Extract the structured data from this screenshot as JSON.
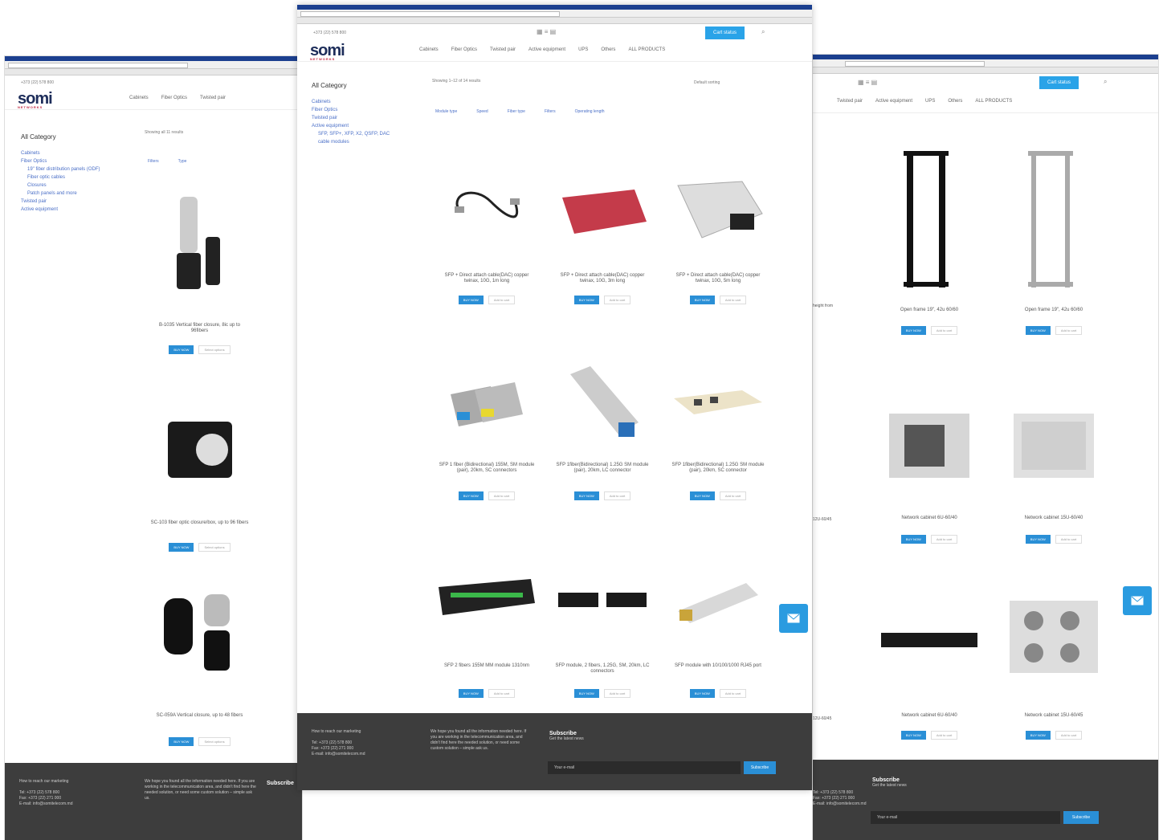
{
  "brand": {
    "name": "somi",
    "tagline": "NETWORKS"
  },
  "topbar": {
    "phone": "+373 (22) 578 800",
    "phone_short": "+373 (22) 578 800",
    "cart_label": "Cart status"
  },
  "menu": {
    "items": [
      "Cabinets",
      "Fiber Optics",
      "Twisted pair",
      "Active equipment",
      "UPS",
      "Others",
      "ALL PRODUCTS"
    ]
  },
  "sidebar": {
    "caption": "All Category",
    "left_items": [
      "Cabinets",
      "Fiber Optics",
      "19\" fiber distribution panels (ODF)",
      "Fiber optic cables",
      "Closures",
      "Patch panels and more",
      "Twisted pair",
      "Active equipment"
    ],
    "center_items": [
      "Cabinets",
      "Fiber Optics",
      "Twisted pair",
      "Active equipment",
      "SFP, SFP+, XFP, X2, QSFP, DAC",
      "cable modules"
    ]
  },
  "left_window": {
    "showing": "Showing all 11 results",
    "filters": [
      "Filters",
      "Type"
    ],
    "products": [
      {
        "name": "B-1035 Vertical fiber closure, 8ic up to 96fibers",
        "buy": "BUY NOW",
        "more": "Select options"
      },
      {
        "name": "SC-103 fiber optic closure/box, up to 96 fibers",
        "buy": "BUY NOW",
        "more": "Select options"
      },
      {
        "name": "SC-059A Vertical closure, up to 48 fibers",
        "buy": "BUY NOW",
        "more": "Select options"
      }
    ]
  },
  "center_window": {
    "showing": "Showing 1–12 of 14 results",
    "sort": "Default sorting",
    "filters": [
      "Module type",
      "Speed",
      "Fiber type",
      "Filters",
      "Operating length"
    ],
    "products": [
      {
        "name": "SFP + Direct attach cable(DAC) copper twinax, 10G, 1m long",
        "buy": "BUY NOW",
        "more": "Add to cart"
      },
      {
        "name": "SFP + Direct attach cable(DAC) copper twinax, 10G, 3m long",
        "buy": "BUY NOW",
        "more": "Add to cart"
      },
      {
        "name": "SFP + Direct attach cable(DAC) copper twinax, 10G, 5m long",
        "buy": "BUY NOW",
        "more": "Add to cart"
      },
      {
        "name": "SFP 1 fiber (Bidirectional) 155M, SM module (pair), 20km, SC connectors",
        "buy": "BUY NOW",
        "more": "Add to cart"
      },
      {
        "name": "SFP 1fiber(Bidirectional) 1.25G SM module (pair), 20km, LC connector",
        "buy": "BUY NOW",
        "more": "Add to cart"
      },
      {
        "name": "SFP 1fiber(Bidirectional) 1.25G SM module (pair), 20km, SC connector",
        "buy": "BUY NOW",
        "more": "Add to cart"
      },
      {
        "name": "SFP 2 fibers 155M MM module 1310nm",
        "buy": "BUY NOW",
        "more": "Add to cart"
      },
      {
        "name": "SFP module, 2 fibers, 1.25G, SM, 20km, LC connectors",
        "buy": "BUY NOW",
        "more": "Add to cart"
      },
      {
        "name": "SFP module with 10/100/1000 RJ45 port",
        "buy": "BUY NOW",
        "more": "Add to cart"
      }
    ]
  },
  "right_window": {
    "products": [
      {
        "name": "Open frame 19\", 42u 60/60",
        "buy": "BUY NOW",
        "more": "Add to cart"
      },
      {
        "name": "Open frame 19\", 42u 60/60",
        "buy": "BUY NOW",
        "more": "Add to cart"
      },
      {
        "name": "Network cabinet 6U-60/40",
        "buy": "BUY NOW",
        "more": "Add to cart"
      },
      {
        "name": "Network cabinet 15U-60/40",
        "buy": "BUY NOW",
        "more": "Add to cart"
      },
      {
        "name": "Network cabinet 6U-60/40",
        "buy": "BUY NOW",
        "more": "Add to cart"
      },
      {
        "name": "Network cabinet 15U-60/45",
        "buy": "BUY NOW",
        "more": "Add to cart"
      }
    ],
    "partial_labels": [
      "height from",
      "12U-60/45",
      "12U-60/45"
    ]
  },
  "footer": {
    "contact_title": "How to reach our marketing",
    "tel": "Tel: +373 (22) 578 800",
    "fax": "Fax: +373 (22) 271 000",
    "email": "E-mail: info@somitelecom.md",
    "about": "We hope you found all the information needed here. If you are working in the telecommunication area, and didn't find here the needed solution, or need some custom solution – simple ask us.",
    "subscribe_title": "Subscribe",
    "subscribe_text": "Get the latest news",
    "email_placeholder": "Your e-mail",
    "subscribe_button": "Subscribe"
  },
  "colors": {
    "accent": "#2a8fd6",
    "footer": "#3d3d3d",
    "brand": "#1d2d5a"
  }
}
